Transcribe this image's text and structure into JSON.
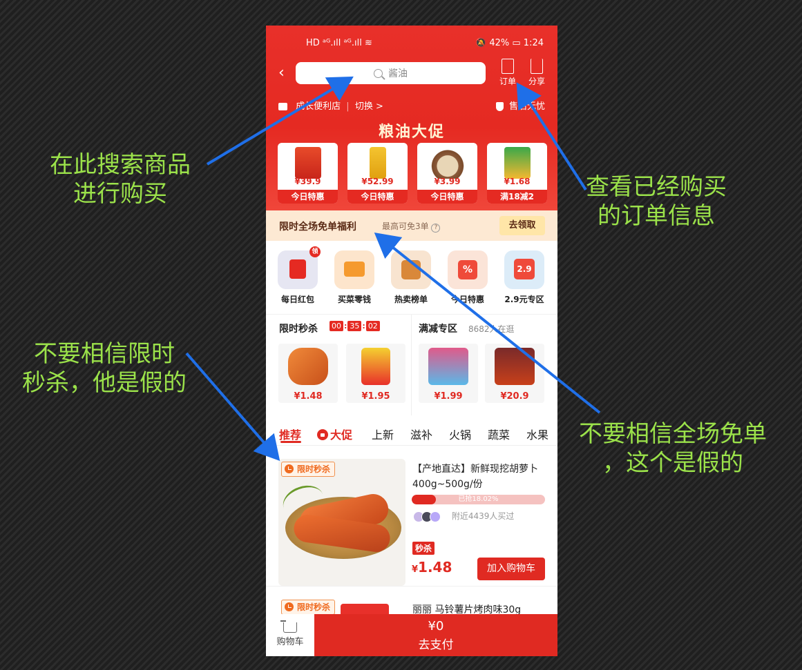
{
  "status_bar": {
    "left": "HD  ᵃᴳ.ıll ᵃᴳ.ıll ≋",
    "battery": "42%",
    "time": "1:24"
  },
  "header": {
    "search_placeholder": "酱油",
    "orders_label": "订单",
    "share_label": "分享"
  },
  "store": {
    "name": "成长便利店",
    "switch_label": "切换 >",
    "guarantee": "售后无忧"
  },
  "promo": {
    "title": "粮油大促",
    "deals": [
      {
        "price": "¥39.9",
        "tag": "今日特惠"
      },
      {
        "price": "¥52.99",
        "tag": "今日特惠"
      },
      {
        "price": "¥3.99",
        "tag": "今日特惠"
      },
      {
        "price": "¥1.68",
        "tag": "满18减2"
      }
    ]
  },
  "free_banner": {
    "title": "限时全场免单福利",
    "subtitle": "最高可免3单",
    "button": "去领取"
  },
  "quick_icons": [
    {
      "label": "每日红包",
      "badge": "领"
    },
    {
      "label": "买菜零钱"
    },
    {
      "label": "热卖榜单"
    },
    {
      "label": "今日特惠"
    },
    {
      "label": "2.9元专区",
      "badge_text": "2.9"
    }
  ],
  "flash_sale": {
    "title": "限时秒杀",
    "timer": [
      "00",
      "35",
      "02"
    ],
    "items": [
      {
        "price": "¥1.48"
      },
      {
        "price": "¥1.95"
      }
    ]
  },
  "manjian": {
    "title": "满减专区",
    "subtitle": "8682人在逛",
    "items": [
      {
        "price": "¥1.99"
      },
      {
        "price": "¥20.9"
      }
    ]
  },
  "tabs": [
    "推荐",
    "大促",
    "上新",
    "滋补",
    "火锅",
    "蔬菜",
    "水果"
  ],
  "product": {
    "flash_tag": "限时秒杀",
    "title": "【产地直达】新鲜现挖胡萝卜400g~500g/份",
    "progress_text": "已抢18.02%",
    "progress_value": 18.02,
    "buyers": "附近4439人买过",
    "miao_tag": "秒杀",
    "currency": "¥",
    "price": "1.48",
    "add_cart": "加入购物车"
  },
  "product2": {
    "flash_tag": "限时秒杀",
    "title": "丽丽 马铃薯片烤肉味30g"
  },
  "bottom_bar": {
    "cart_label": "购物车",
    "amount": "¥0",
    "pay_label": "去支付"
  },
  "annotations": {
    "search": [
      "在此搜索商品",
      "进行购买"
    ],
    "orders": [
      "查看已经购买",
      "的订单信息"
    ],
    "flash_fake": [
      "不要相信限时",
      "秒杀，他是假的"
    ],
    "free_fake": [
      "不要相信全场免单",
      "，这个是假的"
    ]
  },
  "colors": {
    "brand_red": "#e02a22",
    "annotation_green": "#9be24a",
    "arrow_blue": "#1f6fe8"
  }
}
